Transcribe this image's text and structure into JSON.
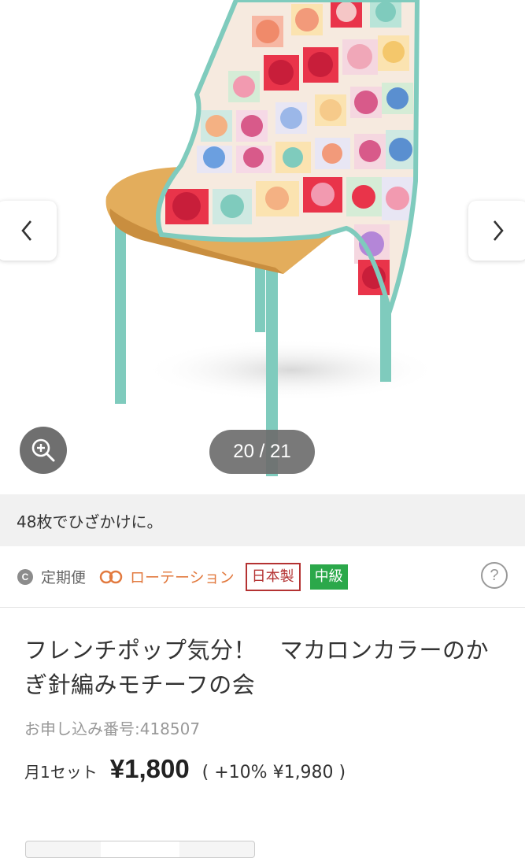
{
  "gallery": {
    "counter": "20 / 21",
    "caption": "48枚でひざかけに。",
    "icons": {
      "prev": "chevron-left-icon",
      "next": "chevron-right-icon",
      "zoom": "zoom-in-icon"
    }
  },
  "tags": {
    "plan_badge": "C",
    "plan_label": "定期便",
    "rotation_label": "ローテーション",
    "made_in": "日本製",
    "level": "中級",
    "help": "?"
  },
  "product": {
    "title": "フレンチポップ気分！　マカロンカラーのかぎ針編みモチーフの会",
    "order_number": "お申し込み番号:418507",
    "price_unit": "月1セット",
    "price": "¥1,800",
    "price_tax": "( +10%  ¥1,980 )"
  },
  "colors": {
    "rotation": "#e27a3f",
    "made_in": "#b43232",
    "level_bg": "#2ba84a",
    "chair_seat": "#e3ad5c",
    "chair_legs": "#7fcbbd"
  }
}
